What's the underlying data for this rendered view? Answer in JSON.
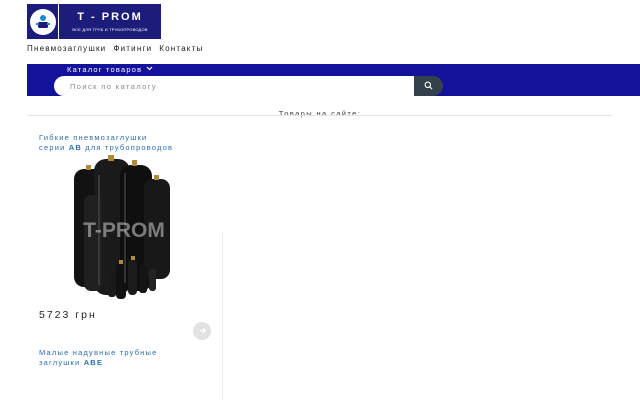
{
  "logo": {
    "title": "T - PROM",
    "subtitle": "ВСЕ ДЛЯ ТРУБ И ТРУБОПРОВОДОВ",
    "watermark": "T-PROM"
  },
  "nav": {
    "items": [
      "Пневмозаглушки",
      "Фитинги",
      "Контакты"
    ]
  },
  "catalog": {
    "label": "Каталог товаров"
  },
  "search": {
    "placeholder": "Поиск по каталогу"
  },
  "section": {
    "title": "Товары на сайте:"
  },
  "products": [
    {
      "title_line1": "Гибкие пневмозаглушки",
      "title_line2_pre": "серии ",
      "title_series": "АВ",
      "title_line2_post": " для трубопроводов",
      "price": "5723 грн"
    },
    {
      "title_line1": "Малые надувные трубные",
      "title_line2_pre": "заглушки ",
      "title_series": "ABE",
      "title_line2_post": ""
    }
  ],
  "colors": {
    "brand": "#1c1c7a",
    "bar": "#12129a",
    "link": "#2a6fb0",
    "search_button": "#34404a"
  },
  "icons": {
    "logo": "plumber-icon",
    "catalog": "chevron-down-icon",
    "search": "search-icon",
    "cart": "arrow-icon"
  }
}
